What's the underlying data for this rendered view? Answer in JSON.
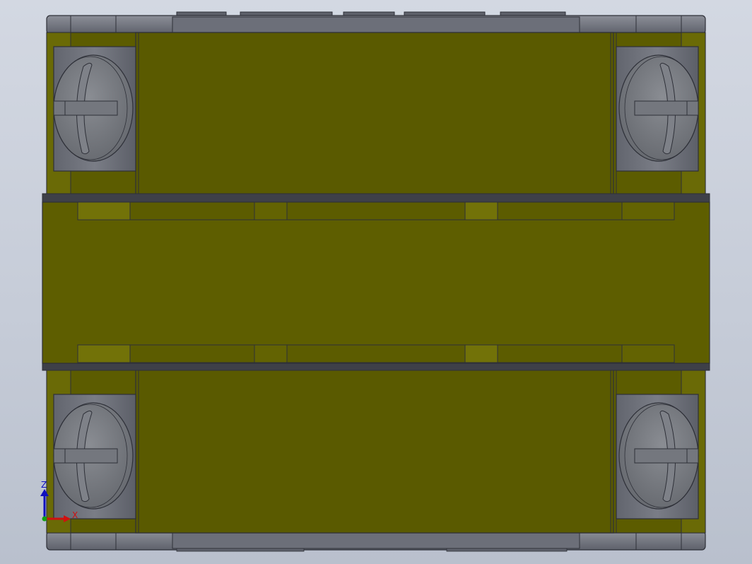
{
  "scene": {
    "description_label": "",
    "colors": {
      "background_top": "#d3d8e2",
      "background_bottom": "#b9c0cd",
      "body_olive": "#5c5c00",
      "band_olive": "#6e6e0a",
      "highlight_olive": "#7a7a10",
      "edge_dark": "#2e3038",
      "frame_gray": "#6c6f79",
      "frame_light": "#8c8f98",
      "screw_gray": "#787b82",
      "axis_x": "#d01010",
      "axis_y": "#10a010",
      "axis_z": "#1010c0"
    },
    "icons": [
      "screw-head-icon",
      "coordinate-triad-icon"
    ]
  },
  "triad": {
    "z_label": "Z",
    "x_label": "X"
  }
}
